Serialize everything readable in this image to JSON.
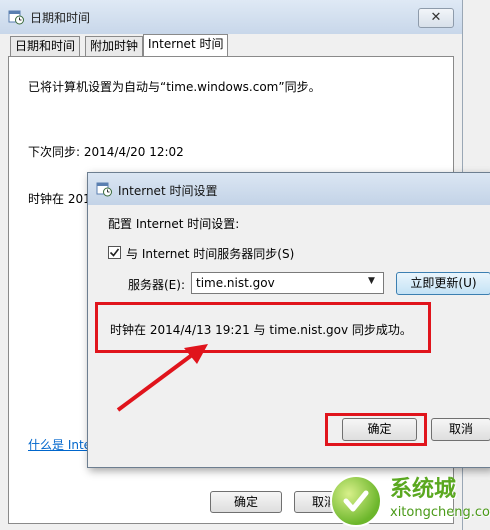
{
  "main_window": {
    "title": "日期和时间",
    "close_glyph": "✕",
    "tabs": [
      "日期和时间",
      "附加时钟",
      "Internet 时间"
    ],
    "sync_status": "已将计算机设置为自动与“time.windows.com”同步。",
    "next_sync": "下次同步: 2014/4/20 12:02",
    "clock_prefix": "时钟在 201",
    "help_link": "什么是 Inte",
    "ok_label": "确定",
    "cancel_label": "取消"
  },
  "dialog": {
    "title": "Internet 时间设置",
    "config_label": "配置 Internet 时间设置:",
    "sync_checkbox_label": "与 Internet 时间服务器同步(S)",
    "sync_checked": true,
    "server_label": "服务器(E):",
    "server_value": "time.nist.gov",
    "update_button": "立即更新(U)",
    "result_text": "时钟在 2014/4/13 19:21 与 time.nist.gov 同步成功。",
    "ok_label": "确定",
    "cancel_label": "取消"
  },
  "watermark": {
    "text_cn": "系统城",
    "url": "xitongcheng.com"
  },
  "colors": {
    "annotation": "#e0141c",
    "link": "#0066cc"
  }
}
